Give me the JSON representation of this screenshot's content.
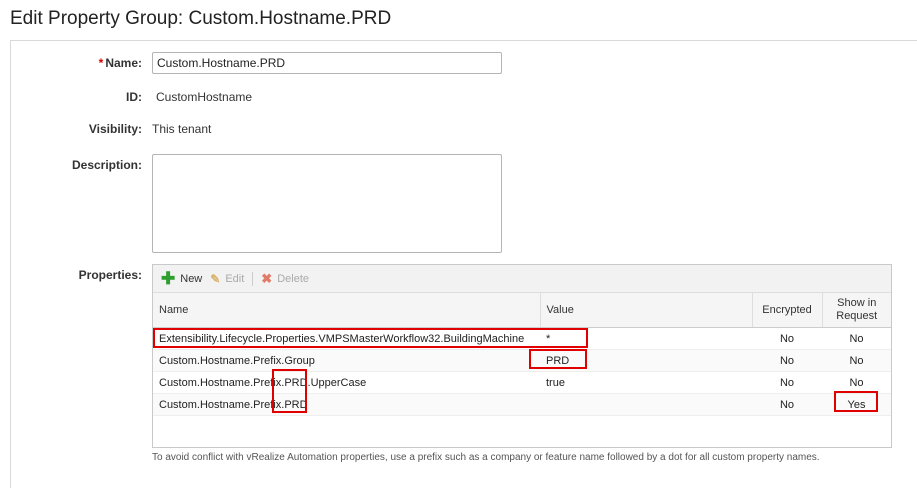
{
  "page": {
    "title": "Edit Property Group: Custom.Hostname.PRD"
  },
  "form": {
    "name_label": "Name:",
    "name_required": "*",
    "name_value": "Custom.Hostname.PRD",
    "id_label": "ID:",
    "id_value": "CustomHostname",
    "visibility_label": "Visibility:",
    "visibility_value": "This tenant",
    "description_label": "Description:",
    "description_value": "",
    "properties_label": "Properties:"
  },
  "toolbar": {
    "new_label": "New",
    "edit_label": "Edit",
    "delete_label": "Delete"
  },
  "grid": {
    "columns": [
      "Name",
      "Value",
      "Encrypted",
      "Show in\nRequest"
    ],
    "rows": [
      {
        "name": "Extensibility.Lifecycle.Properties.VMPSMasterWorkflow32.BuildingMachine",
        "value": "*",
        "encrypted": "No",
        "show": "No"
      },
      {
        "name": "Custom.Hostname.Prefix.Group",
        "value": "PRD",
        "encrypted": "No",
        "show": "No"
      },
      {
        "name": "Custom.Hostname.Prefix.PRD.UpperCase",
        "value": "true",
        "encrypted": "No",
        "show": "No"
      },
      {
        "name": "Custom.Hostname.Prefix.PRD",
        "value": "",
        "encrypted": "No",
        "show": "Yes"
      }
    ]
  },
  "footer_note": "To avoid conflict with vRealize Automation properties, use a prefix such as a company or feature name followed by a dot for all custom property names.",
  "colors": {
    "highlight": "#e00000",
    "new_icon": "#2e9e2e",
    "delete_icon": "#e27a6a"
  }
}
